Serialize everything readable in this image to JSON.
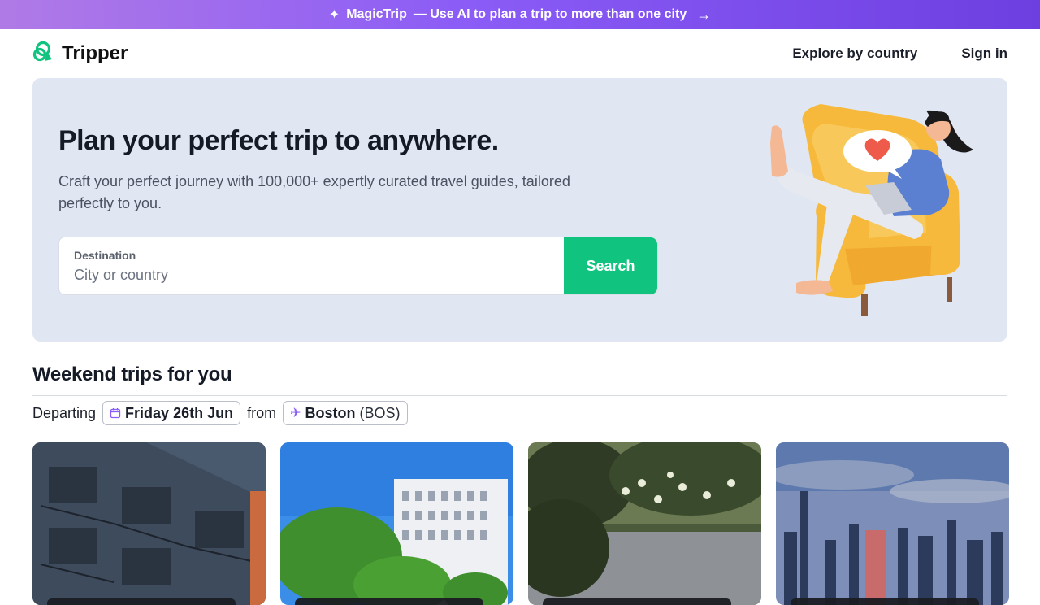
{
  "promo": {
    "brand": "MagicTrip",
    "text": "— Use AI to plan a trip to more than one city",
    "spark_icon": "sparkle-icon",
    "arrow_icon": "arrow-right-icon"
  },
  "nav": {
    "logo_text": "Tripper",
    "explore_label": "Explore by country",
    "signin_label": "Sign in"
  },
  "hero": {
    "title": "Plan your perfect trip to anywhere.",
    "subtitle": "Craft your perfect journey with 100,000+ expertly curated travel guides, tailored perfectly to you.",
    "search": {
      "label": "Destination",
      "placeholder": "City or country",
      "button": "Search"
    }
  },
  "weekend": {
    "title": "Weekend trips for you",
    "departing_label": "Departing",
    "date": "Friday 26th Jun",
    "from_label": "from",
    "city": "Boston",
    "code": "(BOS)"
  },
  "colors": {
    "accent": "#10c47f",
    "promo_start": "#b07ae6",
    "promo_end": "#6d3fe0",
    "hero_bg": "#e0e6f2"
  }
}
